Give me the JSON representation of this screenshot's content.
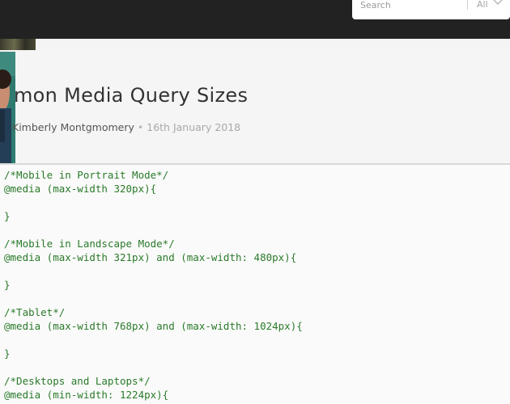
{
  "topbar": {
    "search": {
      "placeholder": "Search",
      "scope": "All"
    }
  },
  "article": {
    "title_visible": "mon Media Query Sizes",
    "author": "Kimberly Montgmomery",
    "separator": "•",
    "date": "16th January 2018"
  },
  "code": {
    "lines": [
      "/*Mobile in Portrait Mode*/",
      "@media (max-width 320px){",
      "",
      "}",
      "",
      "/*Mobile in Landscape Mode*/",
      "@media (max-width 321px) and (max-width: 480px){",
      "",
      "}",
      "",
      "/*Tablet*/",
      "@media (max-width 768px) and (max-width: 1024px){",
      "",
      "}",
      "",
      "/*Desktops and Laptops*/",
      "@media (min-width: 1224px){"
    ]
  },
  "icons": {
    "scope_chevron": "chevron-down-icon"
  },
  "colors": {
    "topbar": "#222222",
    "code_text": "#2a7a2a",
    "date": "#a8a8a8"
  }
}
